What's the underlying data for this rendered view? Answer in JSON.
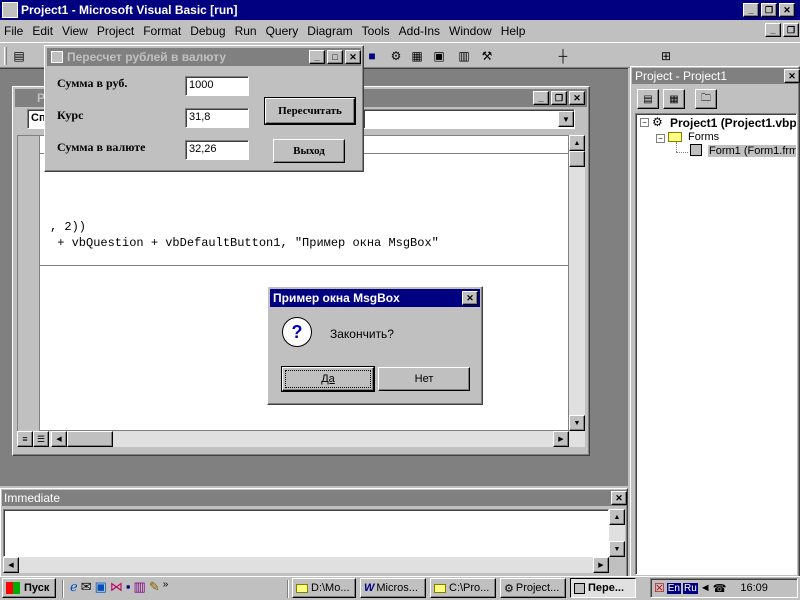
{
  "app": {
    "title": "Project1 - Microsoft Visual Basic [run]"
  },
  "menu": [
    "File",
    "Edit",
    "View",
    "Project",
    "Format",
    "Debug",
    "Run",
    "Query",
    "Diagram",
    "Tools",
    "Add-Ins",
    "Window",
    "Help"
  ],
  "form": {
    "title": "Пересчет рублей в валюту",
    "label_rub": "Сумма в руб.",
    "value_rub": "1000",
    "label_rate": "Курс",
    "value_rate": "31,8",
    "label_currency": "Сумма в валюте",
    "value_currency": "32,26",
    "recalc_button": "Пересчитать",
    "exit_button": "Выход"
  },
  "code_window": {
    "title_fragment": "P",
    "object_combo": "Сп",
    "line1": ", 2))",
    "line2": " + vbQuestion + vbDefaultButton1, \"Пример окна MsgBox\""
  },
  "msgbox": {
    "title": "Пример окна MsgBox",
    "message": "Закончить?",
    "yes": "Да",
    "no": "Нет",
    "icon": "question-icon"
  },
  "project_panel": {
    "title": "Project - Project1",
    "root": "Project1 (Project1.vbp",
    "folder": "Forms",
    "item": "Form1 (Form1.frm"
  },
  "immediate": {
    "title": "Immediate"
  },
  "taskbar": {
    "start": "Пуск",
    "tasks": [
      "D:\\Mo...",
      "Micros...",
      "C:\\Pro...",
      "Project...",
      "Пере..."
    ],
    "lang_en": "En",
    "lang_ru": "Ru",
    "clock": "16:09"
  },
  "colors": {
    "titlebar": "#000080",
    "face": "#c0c0c0",
    "desktop": "#808080"
  }
}
